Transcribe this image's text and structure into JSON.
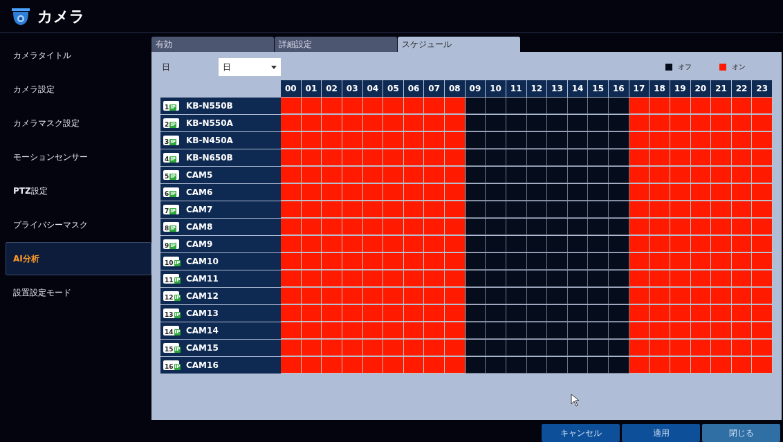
{
  "window": {
    "title": "カメラ"
  },
  "sidebar": {
    "items": [
      {
        "label": "カメラタイトル",
        "selected": false
      },
      {
        "label": "カメラ設定",
        "selected": false
      },
      {
        "label": "カメラマスク設定",
        "selected": false
      },
      {
        "label": "モーションセンサー",
        "selected": false
      },
      {
        "label": "**PTZ**設定",
        "selected": false
      },
      {
        "label": "プライバシーマスク",
        "selected": false
      },
      {
        "label": "**AI**分析",
        "selected": true
      },
      {
        "label": "設置設定モード",
        "selected": false
      }
    ]
  },
  "tabs": [
    {
      "label": "有効",
      "selected": false
    },
    {
      "label": "詳細設定",
      "selected": false
    },
    {
      "label": "スケジュール",
      "selected": true
    }
  ],
  "day": {
    "label": "日",
    "value": "日"
  },
  "legend": [
    {
      "label": "オフ",
      "color": "#050d1c"
    },
    {
      "label": "オン",
      "color": "#ff1a00"
    }
  ],
  "hours": [
    "00",
    "01",
    "02",
    "03",
    "04",
    "05",
    "06",
    "07",
    "08",
    "09",
    "10",
    "11",
    "12",
    "13",
    "14",
    "15",
    "16",
    "17",
    "18",
    "19",
    "20",
    "21",
    "22",
    "23"
  ],
  "cameras": [
    {
      "number": "1",
      "tag": "IP",
      "name": "KB-N550B",
      "on": [
        true,
        true,
        true,
        true,
        true,
        true,
        true,
        true,
        true,
        false,
        false,
        false,
        false,
        false,
        false,
        false,
        false,
        true,
        true,
        true,
        true,
        true,
        true,
        true
      ]
    },
    {
      "number": "2",
      "tag": "IP",
      "name": "KB-N550A",
      "on": [
        true,
        true,
        true,
        true,
        true,
        true,
        true,
        true,
        true,
        false,
        false,
        false,
        false,
        false,
        false,
        false,
        false,
        true,
        true,
        true,
        true,
        true,
        true,
        true
      ]
    },
    {
      "number": "3",
      "tag": "IP",
      "name": "KB-N450A",
      "on": [
        true,
        true,
        true,
        true,
        true,
        true,
        true,
        true,
        true,
        false,
        false,
        false,
        false,
        false,
        false,
        false,
        false,
        true,
        true,
        true,
        true,
        true,
        true,
        true
      ]
    },
    {
      "number": "4",
      "tag": "IP",
      "name": "KB-N650B",
      "on": [
        true,
        true,
        true,
        true,
        true,
        true,
        true,
        true,
        true,
        false,
        false,
        false,
        false,
        false,
        false,
        false,
        false,
        true,
        true,
        true,
        true,
        true,
        true,
        true
      ]
    },
    {
      "number": "5",
      "tag": "IP",
      "name": "CAM5",
      "on": [
        true,
        true,
        true,
        true,
        true,
        true,
        true,
        true,
        true,
        false,
        false,
        false,
        false,
        false,
        false,
        false,
        false,
        true,
        true,
        true,
        true,
        true,
        true,
        true
      ]
    },
    {
      "number": "6",
      "tag": "IP",
      "name": "CAM6",
      "on": [
        true,
        true,
        true,
        true,
        true,
        true,
        true,
        true,
        true,
        false,
        false,
        false,
        false,
        false,
        false,
        false,
        false,
        true,
        true,
        true,
        true,
        true,
        true,
        true
      ]
    },
    {
      "number": "7",
      "tag": "IP",
      "name": "CAM7",
      "on": [
        true,
        true,
        true,
        true,
        true,
        true,
        true,
        true,
        true,
        false,
        false,
        false,
        false,
        false,
        false,
        false,
        false,
        true,
        true,
        true,
        true,
        true,
        true,
        true
      ]
    },
    {
      "number": "8",
      "tag": "IP",
      "name": "CAM8",
      "on": [
        true,
        true,
        true,
        true,
        true,
        true,
        true,
        true,
        true,
        false,
        false,
        false,
        false,
        false,
        false,
        false,
        false,
        true,
        true,
        true,
        true,
        true,
        true,
        true
      ]
    },
    {
      "number": "9",
      "tag": "IP",
      "name": "CAM9",
      "on": [
        true,
        true,
        true,
        true,
        true,
        true,
        true,
        true,
        true,
        false,
        false,
        false,
        false,
        false,
        false,
        false,
        false,
        true,
        true,
        true,
        true,
        true,
        true,
        true
      ]
    },
    {
      "number": "10",
      "tag": "IP",
      "name": "CAM10",
      "on": [
        true,
        true,
        true,
        true,
        true,
        true,
        true,
        true,
        true,
        false,
        false,
        false,
        false,
        false,
        false,
        false,
        false,
        true,
        true,
        true,
        true,
        true,
        true,
        true
      ]
    },
    {
      "number": "11",
      "tag": "IP",
      "name": "CAM11",
      "on": [
        true,
        true,
        true,
        true,
        true,
        true,
        true,
        true,
        true,
        false,
        false,
        false,
        false,
        false,
        false,
        false,
        false,
        true,
        true,
        true,
        true,
        true,
        true,
        true
      ]
    },
    {
      "number": "12",
      "tag": "IP",
      "name": "CAM12",
      "on": [
        true,
        true,
        true,
        true,
        true,
        true,
        true,
        true,
        true,
        false,
        false,
        false,
        false,
        false,
        false,
        false,
        false,
        true,
        true,
        true,
        true,
        true,
        true,
        true
      ]
    },
    {
      "number": "13",
      "tag": "IP",
      "name": "CAM13",
      "on": [
        true,
        true,
        true,
        true,
        true,
        true,
        true,
        true,
        true,
        false,
        false,
        false,
        false,
        false,
        false,
        false,
        false,
        true,
        true,
        true,
        true,
        true,
        true,
        true
      ]
    },
    {
      "number": "14",
      "tag": "IP",
      "name": "CAM14",
      "on": [
        true,
        true,
        true,
        true,
        true,
        true,
        true,
        true,
        true,
        false,
        false,
        false,
        false,
        false,
        false,
        false,
        false,
        true,
        true,
        true,
        true,
        true,
        true,
        true
      ]
    },
    {
      "number": "15",
      "tag": "IP",
      "name": "CAM15",
      "on": [
        true,
        true,
        true,
        true,
        true,
        true,
        true,
        true,
        true,
        false,
        false,
        false,
        false,
        false,
        false,
        false,
        false,
        true,
        true,
        true,
        true,
        true,
        true,
        true
      ]
    },
    {
      "number": "16",
      "tag": "IP",
      "name": "CAM16",
      "on": [
        true,
        true,
        true,
        true,
        true,
        true,
        true,
        true,
        true,
        false,
        false,
        false,
        false,
        false,
        false,
        false,
        false,
        true,
        true,
        true,
        true,
        true,
        true,
        true
      ]
    }
  ],
  "buttons": [
    {
      "label": "キャンセル",
      "kind": "normal"
    },
    {
      "label": "適用",
      "kind": "normal"
    },
    {
      "label": "閉じる",
      "kind": "muted"
    }
  ]
}
